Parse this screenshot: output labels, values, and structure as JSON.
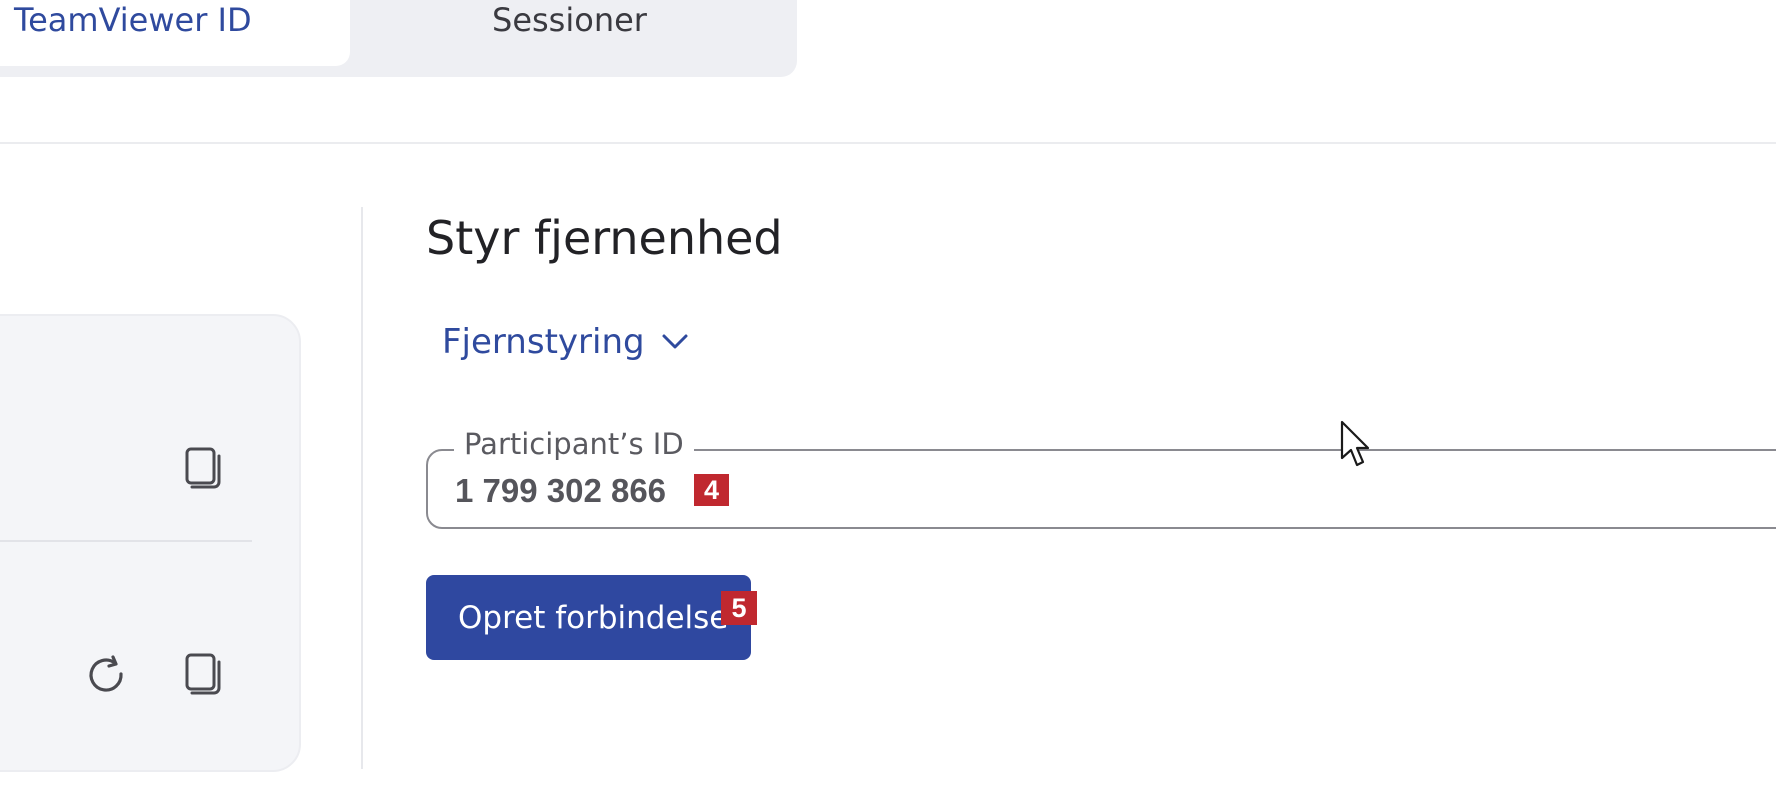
{
  "tabs": {
    "active": "TeamViewer ID",
    "inactive": "Sessioner"
  },
  "card": {
    "copy_icon": "copy-icon",
    "refresh_icon": "refresh-icon"
  },
  "panel": {
    "heading": "Styr fjernenhed",
    "mode": "Fjernstyring",
    "field_label": "Participant’s ID",
    "field_value": "1 799 302 866",
    "field_badge": "4",
    "connect_label": "Opret forbindelse",
    "connect_badge": "5"
  },
  "colors": {
    "accent": "#2f48a0",
    "link": "#2f4a9e",
    "badge": "#c0282f"
  }
}
